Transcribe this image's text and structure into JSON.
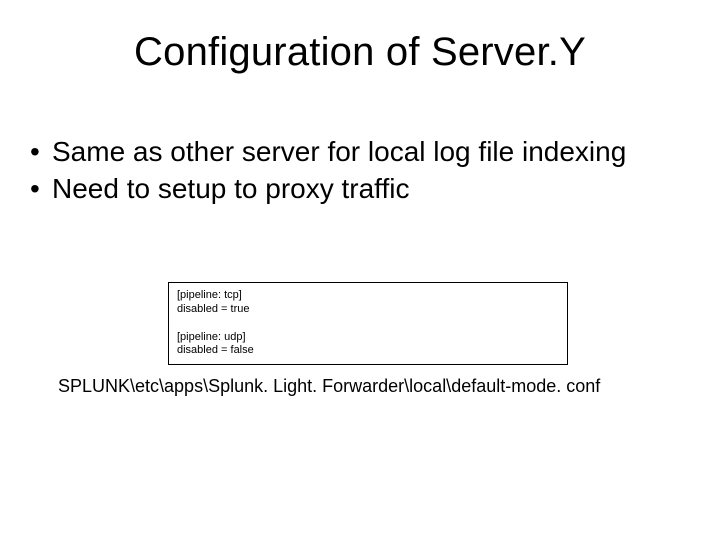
{
  "title": "Configuration of Server.Y",
  "bullets": [
    "Same as other server for local log file indexing",
    "Need to setup to proxy traffic"
  ],
  "config": {
    "blocks": [
      {
        "header": "[pipeline: tcp]",
        "line": "disabled = true"
      },
      {
        "header": "[pipeline: udp]",
        "line": "disabled = false"
      }
    ]
  },
  "path": "SPLUNK\\etc\\apps\\Splunk. Light. Forwarder\\local\\default-mode. conf"
}
